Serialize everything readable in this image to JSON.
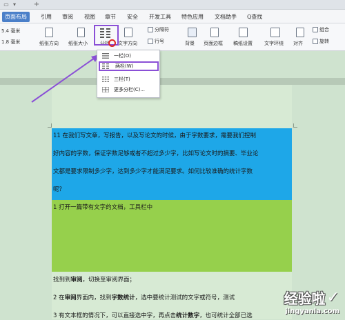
{
  "menubar": {
    "tabs": [
      "页面布局",
      "引用",
      "审阅",
      "视图",
      "章节",
      "安全",
      "开发工具",
      "特色应用",
      "文档助手"
    ],
    "search_label": "Q查找"
  },
  "ribbon": {
    "margin_top": "5.4 毫米",
    "margin_bottom": "1.8 毫米",
    "paper_orientation": "纸张方向",
    "paper_size": "纸张大小",
    "columns": "分栏",
    "text_direction": "文字方向",
    "separator": "分隔符",
    "line_number": "行号",
    "background": "背景",
    "page_border": "页面边框",
    "manuscript": "稿纸设置",
    "text_wrap": "文字环绕",
    "align": "对齐",
    "rotate": "旋转",
    "group": "组合"
  },
  "dropdown": {
    "items": [
      "一栏(O)",
      "两栏(W)",
      "三栏(T)",
      "更多分栏(C)..."
    ]
  },
  "document": {
    "blue_lines": [
      "11 在我们写文章，写报告，以及写论文的时候，由于字数要求，需要我们控制",
      "好内容的字数，保证字数足够或者不超过多少字，比如写论文时的摘要、毕业论",
      "文都是要求限制多少字，达到多少字才能满足要求。如何比较准确的统计字数",
      "呢？"
    ],
    "green_line": "1 打开一篇带有文字的文档，工具栏中",
    "line3_pre": "找到到",
    "line3_bold": "审阅",
    "line3_post": "，切换至审阅界面；",
    "line4_pre": "2 在",
    "line4_bold1": "审阅",
    "line4_mid": "界面内，找到",
    "line4_bold2": "字数统计",
    "line4_post": "，选中要统计测试的文字或符号，测试",
    "line5_pre": "3 有文本框的情况下，可以直接选中字，再点击",
    "line5_bold": "统计数字",
    "line5_post": "，也可统计全部已选"
  },
  "watermark": {
    "text": "经验啦",
    "url": "jingyanla.com"
  },
  "colors": {
    "accent": "#8a4fd6",
    "blue_highlight": "#1ea7e8",
    "green_highlight": "#96d04c",
    "doc_background": "#cfe3cf"
  }
}
